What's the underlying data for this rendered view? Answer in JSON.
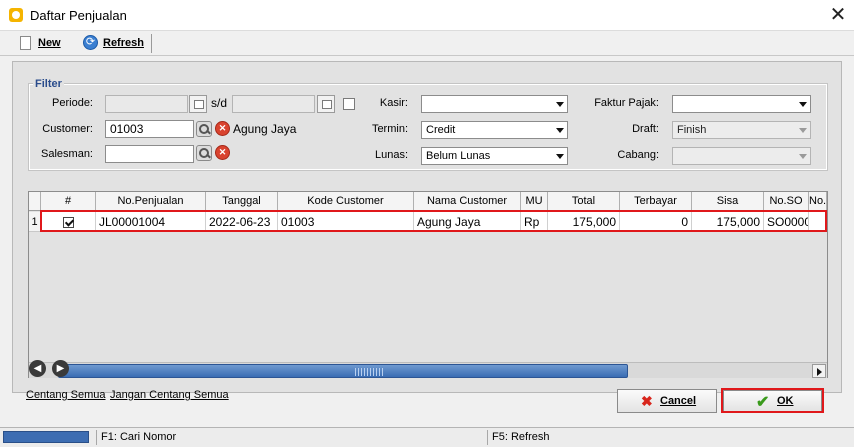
{
  "window": {
    "title": "Daftar Penjualan",
    "close_glyph": "✕"
  },
  "toolbar": {
    "new_label": "New",
    "refresh_label": "Refresh"
  },
  "filter": {
    "legend": "Filter",
    "periode_label": "Periode:",
    "sd_label": "s/d",
    "customer_label": "Customer:",
    "customer_code": "01003",
    "customer_name": "Agung Jaya",
    "salesman_label": "Salesman:",
    "salesman_value": "",
    "kasir_label": "Kasir:",
    "kasir_value": "",
    "termin_label": "Termin:",
    "termin_value": "Credit",
    "lunas_label": "Lunas:",
    "lunas_value": "Belum Lunas",
    "faktur_pajak_label": "Faktur Pajak:",
    "faktur_pajak_value": "",
    "draft_label": "Draft:",
    "draft_value": "Finish",
    "cabang_label": "Cabang:",
    "cabang_value": ""
  },
  "grid": {
    "columns": [
      "#",
      "No.Penjualan",
      "Tanggal",
      "Kode Customer",
      "Nama Customer",
      "MU",
      "Total",
      "Terbayar",
      "Sisa",
      "No.SO",
      "No."
    ],
    "rows": [
      {
        "index": "1",
        "checked": true,
        "no_penjualan": "JL00001004",
        "tanggal": "2022-06-23",
        "kode_customer": "01003",
        "nama_customer": "Agung Jaya",
        "mu": "Rp",
        "total": "175,000",
        "terbayar": "0",
        "sisa": "175,000",
        "no_so": "SO0000",
        "no": ""
      }
    ]
  },
  "links": {
    "check_all": "Centang Semua",
    "uncheck_all": "Jangan Centang Semua"
  },
  "buttons": {
    "cancel_label": "Cancel",
    "ok_label": "OK"
  },
  "statusbar": {
    "hint_f1": "F1: Cari Nomor",
    "hint_f5": "F5: Refresh"
  },
  "colors": {
    "highlight": "#e0181b",
    "scroll_thumb": "#3a6cb3",
    "status_progress": "#3d6db2"
  },
  "icons": {
    "app": "app-logo-icon",
    "new": "new-document-icon",
    "refresh": "refresh-icon",
    "search": "search-icon",
    "clear": "clear-icon",
    "calendar": "calendar-icon",
    "cancel": "cancel-x-icon",
    "ok": "checkmark-icon"
  }
}
